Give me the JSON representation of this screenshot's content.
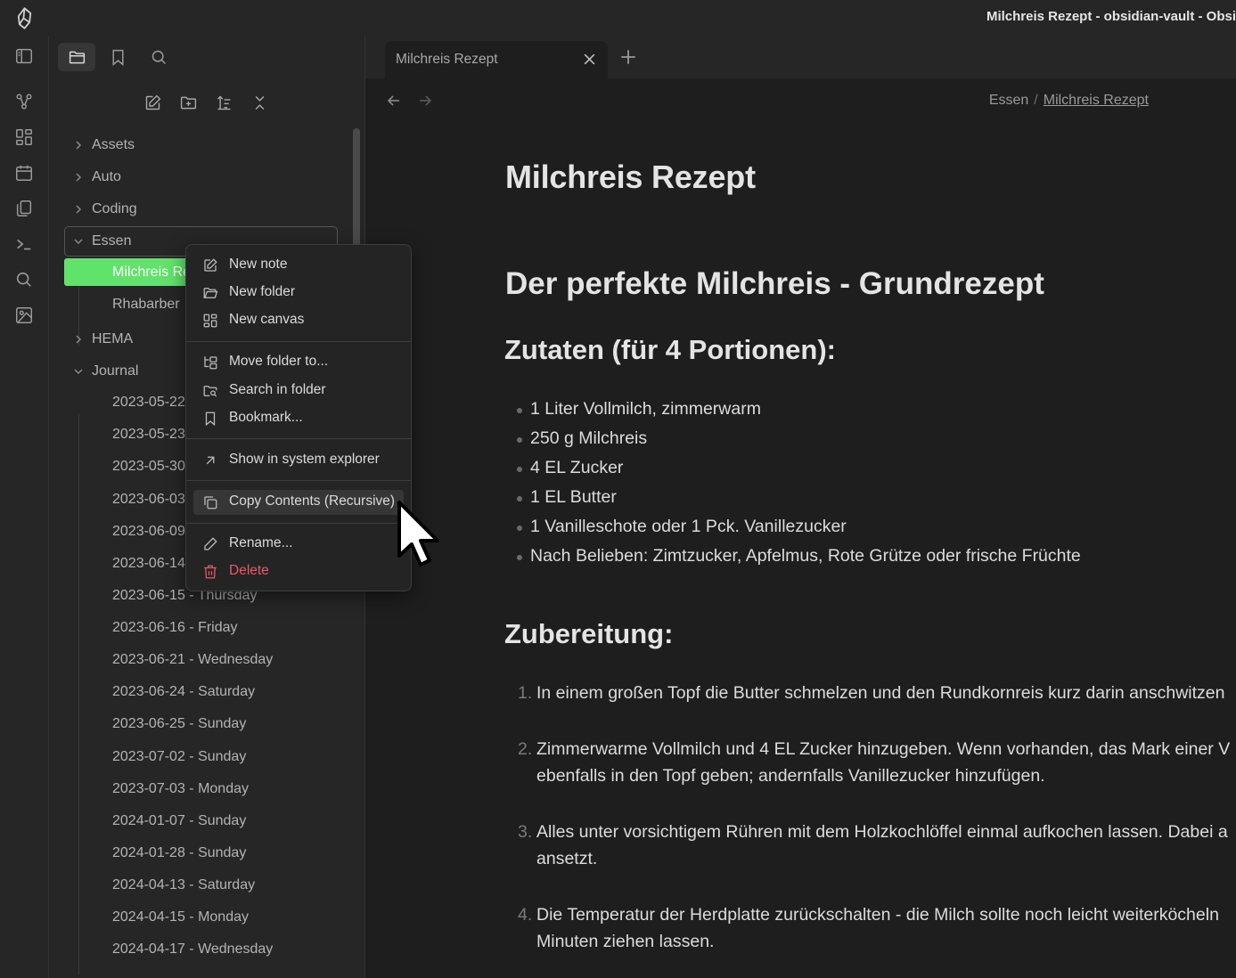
{
  "window": {
    "title": "Milchreis Rezept - obsidian-vault - Obsi"
  },
  "sidebar": {
    "tabs": [
      "files-icon",
      "bookmark-icon",
      "search-icon"
    ],
    "tree": {
      "folders": [
        "Assets",
        "Auto",
        "Coding",
        "Essen",
        "HEMA",
        "Journal"
      ],
      "essen_files": [
        "Milchreis Rezept",
        "Rhabarber"
      ],
      "journal_files": [
        "2023-05-22",
        "2023-05-23",
        "2023-05-30",
        "2023-06-03",
        "2023-06-09",
        "2023-06-14",
        "2023-06-15 - Thursday",
        "2023-06-16 - Friday",
        "2023-06-21 - Wednesday",
        "2023-06-24 - Saturday",
        "2023-06-25 - Sunday",
        "2023-07-02 - Sunday",
        "2023-07-03 - Monday",
        "2024-01-07 - Sunday",
        "2024-01-28 - Sunday",
        "2024-04-13 - Saturday",
        "2024-04-15 - Monday",
        "2024-04-17 - Wednesday"
      ]
    }
  },
  "tab": {
    "label": "Milchreis Rezept"
  },
  "breadcrumb": {
    "parent": "Essen",
    "separator": "/",
    "current": "Milchreis Rezept"
  },
  "document": {
    "title": "Milchreis Rezept",
    "h1": "Der perfekte Milchreis - Grundrezept",
    "ingredients_heading": "Zutaten (für 4 Portionen):",
    "ingredients": [
      "1 Liter Vollmilch, zimmerwarm",
      "250 g Milchreis",
      "4 EL Zucker",
      "1 EL Butter",
      "1 Vanilleschote oder 1 Pck. Vanillezucker",
      "Nach Belieben: Zimtzucker, Apfelmus, Rote Grütze oder frische Früchte"
    ],
    "steps_heading": "Zubereitung:",
    "steps": [
      {
        "num": "1.",
        "line1": "In einem großen Topf die Butter schmelzen und den Rundkornreis kurz darin anschwitzen",
        "line2": ""
      },
      {
        "num": "2.",
        "line1": "Zimmerwarme Vollmilch und 4 EL Zucker hinzugeben. Wenn vorhanden, das Mark einer V",
        "line2": "ebenfalls in den Topf geben; andernfalls Vanillezucker hinzufügen."
      },
      {
        "num": "3.",
        "line1": "Alles unter vorsichtigem Rühren mit dem Holzkochlöffel einmal aufkochen lassen. Dabei a",
        "line2": "ansetzt."
      },
      {
        "num": "4.",
        "line1": "Die Temperatur der Herdplatte zurückschalten - die Milch sollte noch leicht weiterköcheln",
        "line2": "Minuten ziehen lassen."
      }
    ]
  },
  "context_menu": {
    "new_note": "New note",
    "new_folder": "New folder",
    "new_canvas": "New canvas",
    "move_folder": "Move folder to...",
    "search_folder": "Search in folder",
    "bookmark": "Bookmark...",
    "show_explorer": "Show in system explorer",
    "copy_contents": "Copy Contents (Recursive)",
    "rename": "Rename...",
    "delete": "Delete"
  },
  "colors": {
    "active_file": "#60e36a",
    "danger": "#e85a6b",
    "background": "#1e1e1e",
    "panel": "#262626"
  }
}
